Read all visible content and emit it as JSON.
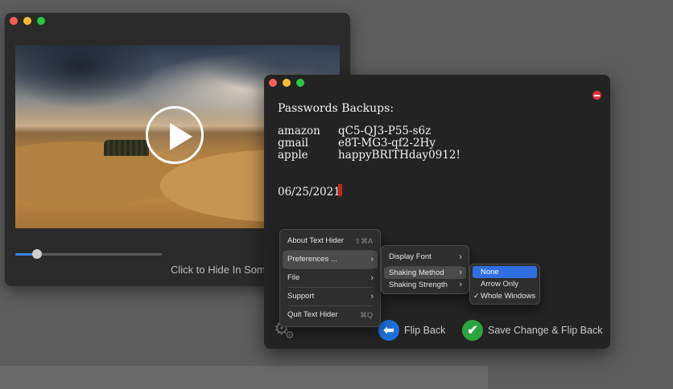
{
  "video_window": {
    "hide_caption": "Click to Hide In Some",
    "progress": 0.15
  },
  "note_window": {
    "title": "Passwords Backups:",
    "passwords": [
      {
        "site": "amazon",
        "password": "qC5-QJ3-P55-s6z"
      },
      {
        "site": "gmail",
        "password": "e8T-MG3-qf2-2Hy"
      },
      {
        "site": "apple",
        "password": "happyBRITHday0912!"
      }
    ],
    "date": "06/25/2021",
    "flip_back_label": "Flip Back",
    "save_flip_label": "Save Change & Flip Back"
  },
  "app_menu": {
    "items": [
      {
        "label": "About Text Hider",
        "shortcut": "⇧⌘A"
      },
      {
        "label": "Preferences ..."
      },
      {
        "label": "File"
      },
      {
        "label": "Support"
      },
      {
        "label": "Quit Text Hider",
        "shortcut": "⌘Q"
      }
    ]
  },
  "preferences_menu": {
    "items": [
      {
        "label": "Display Font"
      },
      {
        "label": "Shaking Method"
      },
      {
        "label": "Shaking Strength"
      }
    ]
  },
  "shaking_menu": {
    "items": [
      {
        "label": "None"
      },
      {
        "label": "Arrow Only"
      },
      {
        "label": "Whole Windows"
      }
    ],
    "checked": "Whole Windows",
    "highlighted": "None"
  },
  "colors": {
    "accent": "#2f6fe0",
    "flip_button": "#1e6fd9",
    "save_button": "#2aa63c",
    "cursor": "#c0281c"
  }
}
